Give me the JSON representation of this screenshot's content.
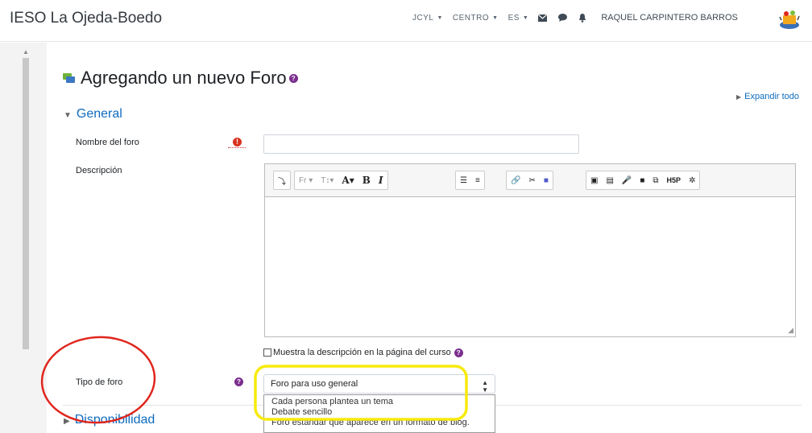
{
  "header": {
    "site_title": "IESO La Ojeda-Boedo",
    "nav": [
      "JCYL",
      "CENTRO",
      "ES"
    ],
    "icons": [
      "envelope-icon",
      "chat-icon",
      "bell-icon"
    ],
    "user_name": "RAQUEL CARPINTERO BARROS"
  },
  "page": {
    "heading": "Agregando un nuevo Foro",
    "expand_all": "Expandir todo",
    "section_general": "General",
    "section_availability": "Disponibilidad"
  },
  "form": {
    "name_label": "Nombre del foro",
    "name_value": "",
    "description_label": "Descripción",
    "show_description_label": "Muestra la descripción en la página del curso",
    "show_description_checked": false,
    "forum_type_label": "Tipo de foro",
    "forum_type_selected": "Foro para uso general",
    "forum_type_options": [
      "Cada persona plantea un tema",
      "Debate sencillo",
      "Foro estándar que aparece en un formato de blog."
    ]
  },
  "editor_toolbar": {
    "font_family_label": "Fr",
    "bold_label": "B",
    "italic_label": "I",
    "h5p_label": "H5P",
    "buttons": [
      "show-more",
      "font-family",
      "font-size",
      "font-color",
      "bold",
      "italic",
      "unordered-list",
      "ordered-list",
      "link",
      "unlink",
      "teams",
      "image",
      "media",
      "record-audio",
      "record-video",
      "manage-files",
      "h5p",
      "accessibility-checker"
    ]
  },
  "colors": {
    "link_blue": "#0f6cbf",
    "required_red": "#d9321f",
    "help_purple": "#7b2e8e",
    "annotation_red": "#e0261e",
    "annotation_yellow": "#f7ea0d"
  }
}
